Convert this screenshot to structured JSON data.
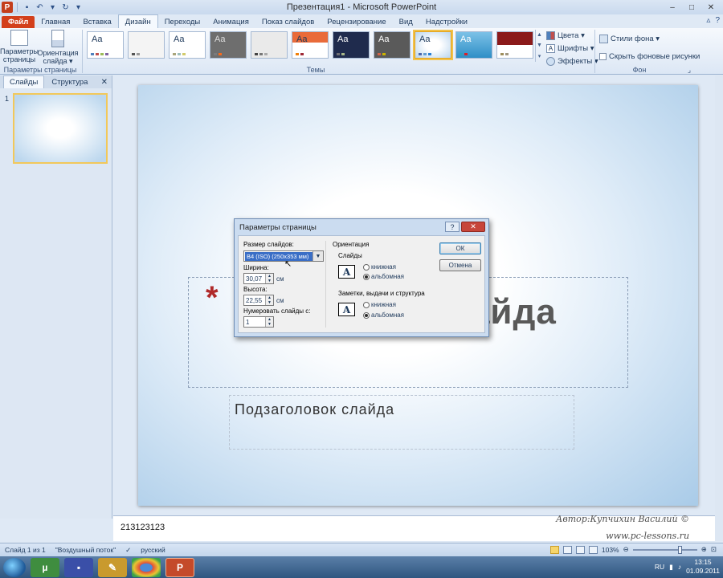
{
  "window": {
    "title": "Презентация1 - Microsoft PowerPoint",
    "app_icon_letter": "P",
    "minimize": "–",
    "maximize": "□",
    "close": "✕"
  },
  "tabs": {
    "file": "Файл",
    "items": [
      "Главная",
      "Вставка",
      "Дизайн",
      "Переходы",
      "Анимация",
      "Показ слайдов",
      "Рецензирование",
      "Вид",
      "Надстройки"
    ],
    "active": "Дизайн"
  },
  "ribbon": {
    "page_setup": {
      "label1": "Параметры страницы",
      "label2": "Ориентация слайда ▾"
    },
    "page_setup_group": "Параметры страницы",
    "themes_group": "Темы",
    "theme_sample": "Aa",
    "colors": "Цвета ▾",
    "fonts": "Шрифты ▾",
    "effects": "Эффекты ▾",
    "bg_styles": "Стили фона ▾",
    "hide_bg": "Скрыть фоновые рисунки",
    "bg_group": "Фон"
  },
  "left_pane": {
    "tab_slides": "Слайды",
    "tab_outline": "Структура",
    "close": "✕",
    "slide_number": "1"
  },
  "slide": {
    "asterisk": "*",
    "title_visible": "лайда",
    "subtitle": "Подзаголовок слайда"
  },
  "dialog": {
    "title": "Параметры страницы",
    "help": "?",
    "close": "✕",
    "size_label": "Размер слайдов:",
    "size_value": "B4 (ISO) (250x353 мм)",
    "width_label": "Ширина:",
    "width_value": "30,07",
    "height_label": "Высота:",
    "height_value": "22,55",
    "unit": "см",
    "number_label": "Нумеровать слайды с:",
    "number_value": "1",
    "orientation_label": "Ориентация",
    "slides_label": "Слайды",
    "portrait": "книжная",
    "landscape": "альбомная",
    "notes_label": "Заметки, выдачи и структура",
    "ok": "ОК",
    "cancel": "Отмена"
  },
  "notes": {
    "text": "213123123"
  },
  "watermark": {
    "line1": "Автор:Купчихин Василий ©",
    "line2": "www.pc-lessons.ru"
  },
  "status": {
    "slide_info": "Слайд 1 из 1",
    "theme_name": "\"Воздушный поток\"",
    "language": "русский",
    "zoom": "103%"
  },
  "taskbar": {
    "lang": "RU",
    "time": "13:15",
    "date": "01.09.2011"
  },
  "colors": {
    "file_tab": "#d33f1b",
    "accent": "#f2c85a"
  }
}
